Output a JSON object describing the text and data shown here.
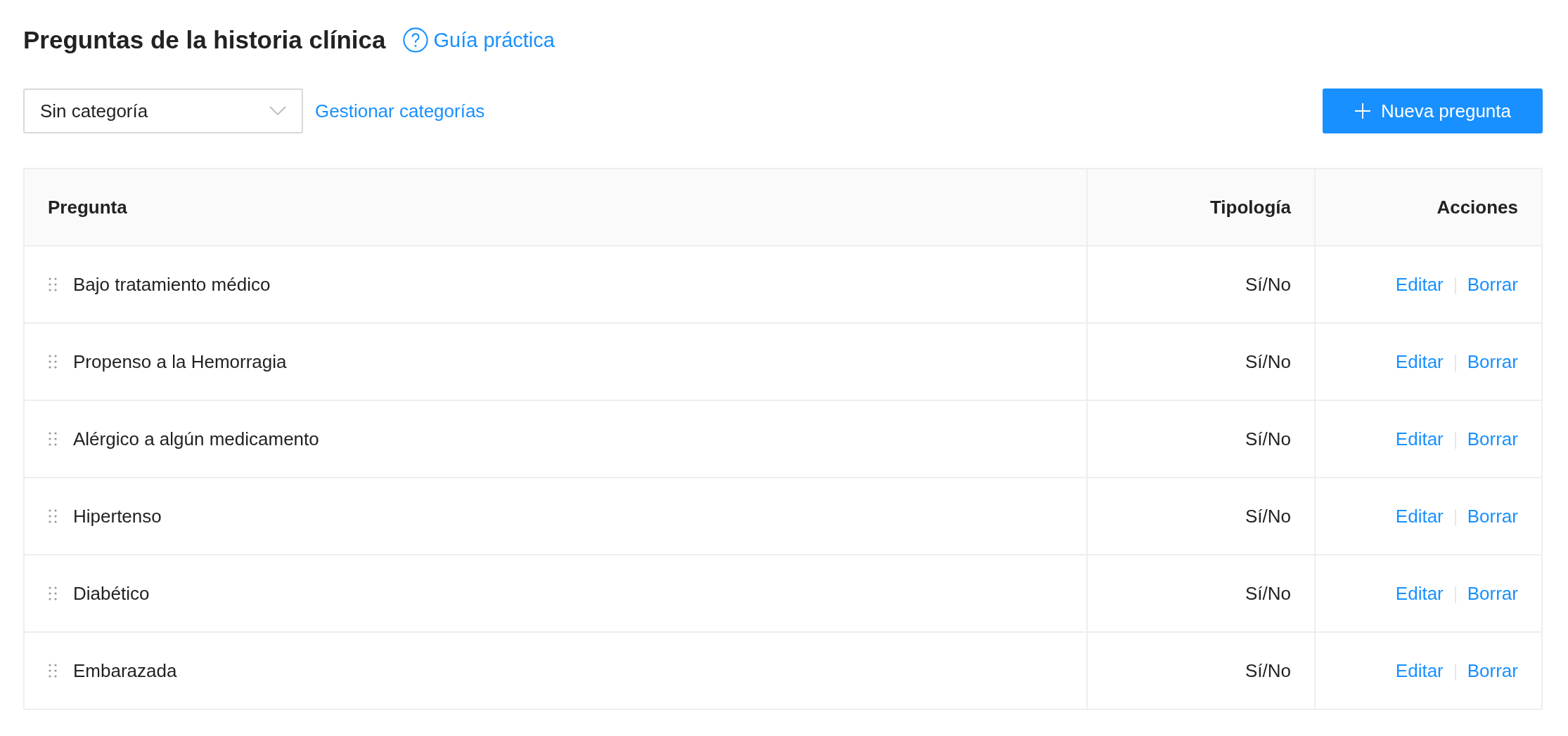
{
  "page": {
    "title": "Preguntas de la historia clínica",
    "help_link": "Guía práctica"
  },
  "toolbar": {
    "category_select": {
      "value": "Sin categoría"
    },
    "manage_link": "Gestionar categorías",
    "new_button": "Nueva pregunta"
  },
  "table": {
    "columns": [
      "Pregunta",
      "Tipología",
      "Acciones"
    ],
    "rows": [
      {
        "question": "Bajo tratamiento médico",
        "type": "Sí/No",
        "actions": [
          "Editar",
          "Borrar"
        ]
      },
      {
        "question": "Propenso a la Hemorragia",
        "type": "Sí/No",
        "actions": [
          "Editar",
          "Borrar"
        ]
      },
      {
        "question": "Alérgico a algún medicamento",
        "type": "Sí/No",
        "actions": [
          "Editar",
          "Borrar"
        ]
      },
      {
        "question": "Hipertenso",
        "type": "Sí/No",
        "actions": [
          "Editar",
          "Borrar"
        ]
      },
      {
        "question": "Diabético",
        "type": "Sí/No",
        "actions": [
          "Editar",
          "Borrar"
        ]
      },
      {
        "question": "Embarazada",
        "type": "Sí/No",
        "actions": [
          "Editar",
          "Borrar"
        ]
      }
    ]
  }
}
